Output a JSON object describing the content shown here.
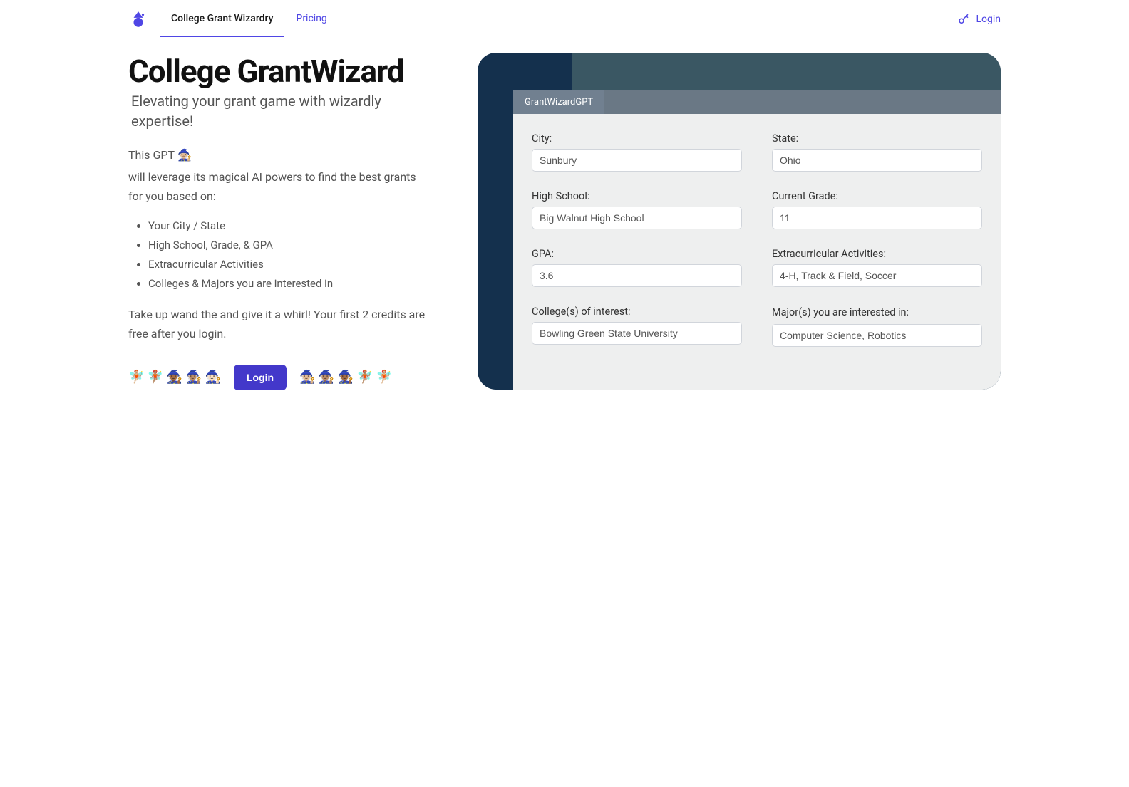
{
  "nav": {
    "tabs": [
      {
        "label": "College Grant Wizardry"
      },
      {
        "label": "Pricing"
      }
    ],
    "login": "Login"
  },
  "hero": {
    "title": "College GrantWizard",
    "subtitle": "Elevating your grant game with wizardly expertise!",
    "desc_pre": "This GPT",
    "desc_emoji": "🧙🏼",
    "desc_post": "will leverage its magical AI powers to find the best grants for you based on:",
    "bullets": [
      "Your City / State",
      "High School, Grade, & GPA",
      "Extracurricular Activities",
      "Colleges & Majors you are interested in"
    ],
    "cta": "Take up wand the and give it a whirl! Your first 2 credits are free after you login.",
    "login_button": "Login",
    "emojis_left": "🧚🏼 🧚🏽 🧙🏾 🧙🏽 🧙🏻",
    "emojis_right": "🧙🏼 🧙🏽 🧙🏾 🧚🏽 🧚🏼"
  },
  "card": {
    "tab_label": "GrantWizardGPT",
    "fields": {
      "city": {
        "label": "City:",
        "value": "Sunbury"
      },
      "state": {
        "label": "State:",
        "value": "Ohio"
      },
      "highschool": {
        "label": "High School:",
        "value": "Big Walnut High School"
      },
      "grade": {
        "label": "Current Grade:",
        "value": "11"
      },
      "gpa": {
        "label": "GPA:",
        "value": "3.6"
      },
      "activities": {
        "label": "Extracurricular Activities:",
        "value": "4-H, Track & Field, Soccer"
      },
      "colleges": {
        "label": "College(s) of interest:",
        "value": "Bowling Green State University"
      },
      "majors": {
        "label": "Major(s) you are interested in:",
        "value": "Computer Science, Robotics"
      }
    }
  }
}
